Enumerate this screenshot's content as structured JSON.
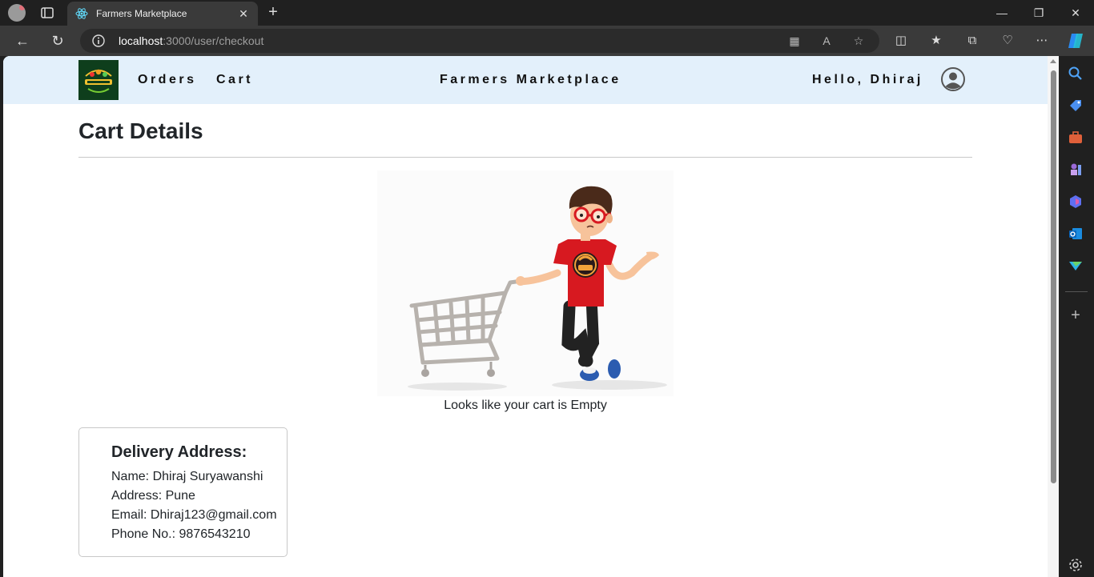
{
  "browser": {
    "tab_title": "Farmers Marketplace",
    "close_glyph": "✕",
    "new_tab_glyph": "+",
    "url_host": "localhost",
    "url_rest": ":3000/user/checkout"
  },
  "site": {
    "nav_links": [
      "Orders",
      "Cart"
    ],
    "brand": "Farmers Marketplace",
    "greeting": "Hello, Dhiraj"
  },
  "page": {
    "title": "Cart Details",
    "empty_message": "Looks like your cart is Empty"
  },
  "address": {
    "title": "Delivery Address:",
    "name": "Name: Dhiraj Suryawanshi",
    "address": "Address: Pune",
    "email": "Email: Dhiraj123@gmail.com",
    "phone": "Phone No.: 9876543210"
  },
  "colors": {
    "nav_background": "#e3f0fb",
    "shirt_red": "#d71920",
    "logo_green": "#0e3e1c"
  }
}
